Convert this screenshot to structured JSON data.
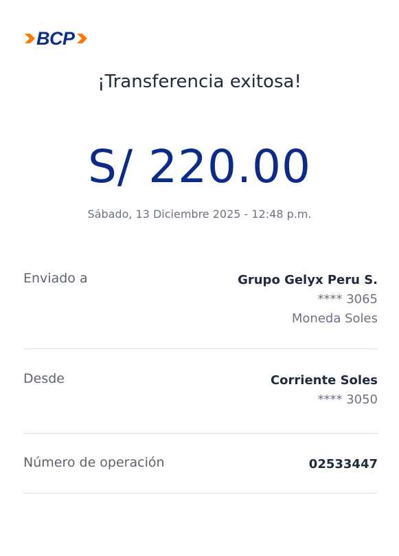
{
  "brand": {
    "logo_text": "BCP",
    "colors": {
      "primary_blue": "#0b2a8a",
      "accent_orange": "#ff7a00"
    },
    "icons": [
      "chevron-right-icon",
      "chevron-right-icon"
    ]
  },
  "title": "¡Transferencia exitosa!",
  "amount": "S/ 220.00",
  "datetime": "Sábado, 13 Diciembre 2025 - 12:48 p.m.",
  "details": {
    "sent_to": {
      "label": "Enviado a",
      "name": "Grupo Gelyx Peru S.",
      "account": "**** 3065",
      "currency": "Moneda Soles"
    },
    "from": {
      "label": "Desde",
      "account_name": "Corriente Soles",
      "account": "**** 3050"
    },
    "operation": {
      "label": "Número de operación",
      "number": "02533447"
    }
  }
}
